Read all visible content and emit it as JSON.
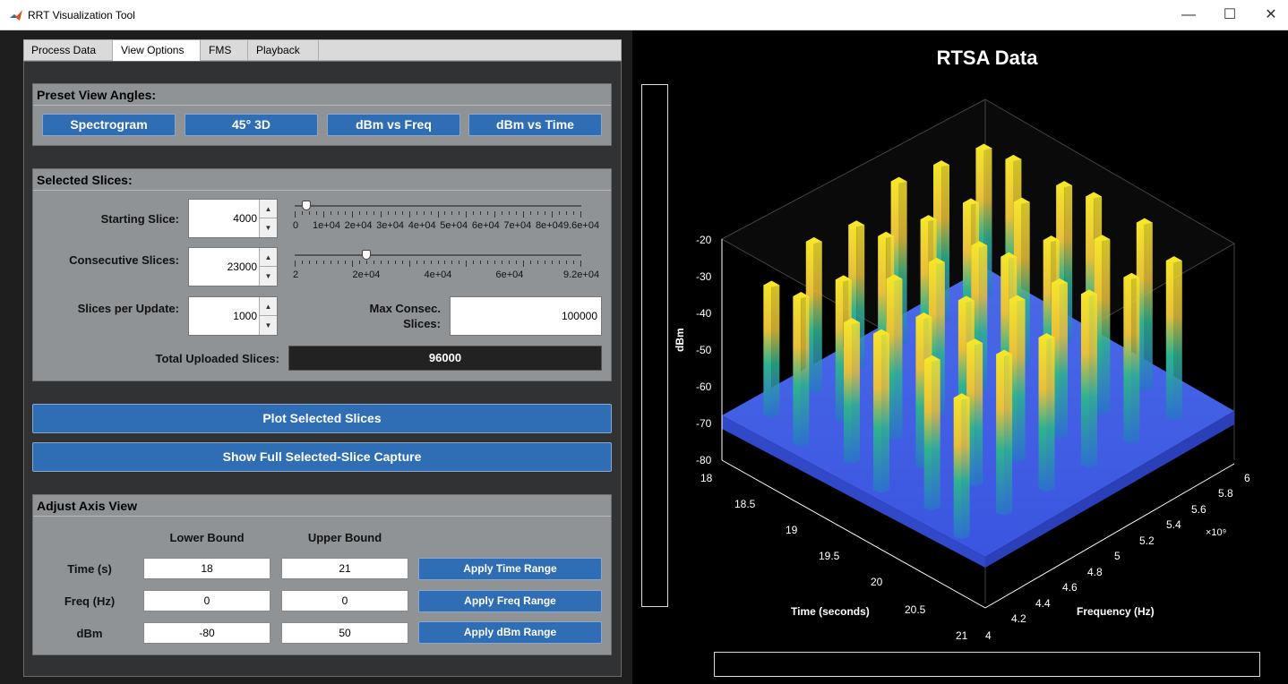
{
  "window": {
    "title": "RRT Visualization Tool",
    "minimize_glyph": "—",
    "maximize_glyph": "☐",
    "close_glyph": "✕"
  },
  "tabs": [
    {
      "label": "Process Data"
    },
    {
      "label": "View Options",
      "active": true
    },
    {
      "label": "FMS"
    },
    {
      "label": "Playback"
    }
  ],
  "preset": {
    "title": "Preset View Angles:",
    "buttons": [
      "Spectrogram",
      "45° 3D",
      "dBm vs Freq",
      "dBm vs Time"
    ]
  },
  "slices": {
    "title": "Selected Slices:",
    "starting_label": "Starting Slice:",
    "starting_value": "4000",
    "starting_slider": {
      "min": 0,
      "max": 96000,
      "value": 4000,
      "tick_labels": [
        "0",
        "1e+04",
        "2e+04",
        "3e+04",
        "4e+04",
        "5e+04",
        "6e+04",
        "7e+04",
        "8e+04",
        "9.6e+04"
      ]
    },
    "consecutive_label": "Consecutive Slices:",
    "consecutive_value": "23000",
    "consecutive_slider": {
      "min": 2,
      "max": 92000,
      "value": 23000,
      "tick_labels": [
        "2",
        "2e+04",
        "4e+04",
        "6e+04",
        "9.2e+04"
      ]
    },
    "per_update_label": "Slices per Update:",
    "per_update_value": "1000",
    "max_consec_label": "Max Consec. Slices:",
    "max_consec_value": "100000",
    "total_label": "Total Uploaded Slices:",
    "total_value": "96000"
  },
  "actions": {
    "plot_label": "Plot Selected Slices",
    "full_capture_label": "Show Full Selected-Slice Capture"
  },
  "axis_view": {
    "title": "Adjust Axis View",
    "lower_header": "Lower Bound",
    "upper_header": "Upper Bound",
    "rows": [
      {
        "label": "Time (s)",
        "lower": "18",
        "upper": "21",
        "button": "Apply Time Range"
      },
      {
        "label": "Freq (Hz)",
        "lower": "0",
        "upper": "0",
        "button": "Apply Freq Range"
      },
      {
        "label": "dBm",
        "lower": "-80",
        "upper": "50",
        "button": "Apply dBm Range"
      }
    ]
  },
  "plot": {
    "title": "RTSA Data",
    "zlabel": "dBm",
    "xlabel": "Time (seconds)",
    "ylabel": "Frequency (Hz)",
    "freq_exponent": "×10⁹",
    "z_ticks": [
      "-20",
      "-30",
      "-40",
      "-50",
      "-60",
      "-70",
      "-80"
    ],
    "time_ticks": [
      "18",
      "18.5",
      "19",
      "19.5",
      "20",
      "20.5",
      "21"
    ],
    "freq_ticks": [
      "6",
      "5.8",
      "5.6",
      "5.4",
      "5.2",
      "5",
      "4.8",
      "4.6",
      "4.4",
      "4.2",
      "4"
    ],
    "colors": {
      "floor": "#3a55e0",
      "peak_top": "#f5e62a",
      "peak_mid": "#2fb28f",
      "grid": "#444444"
    }
  }
}
